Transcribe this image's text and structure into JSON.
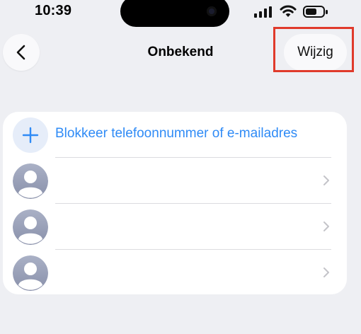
{
  "status_bar": {
    "time": "10:39",
    "icons": [
      "cellular-signal-icon",
      "wifi-icon",
      "battery-icon"
    ]
  },
  "nav": {
    "back_icon": "chevron-left-icon",
    "title": "Onbekend",
    "edit_label": "Wijzig"
  },
  "list": {
    "add_icon": "plus-icon",
    "add_label": "Blokkeer telefoonnummer of e-mailadres",
    "contacts": [
      {
        "name": "",
        "icon": "person-avatar-icon"
      },
      {
        "name": "",
        "icon": "person-avatar-icon"
      },
      {
        "name": "",
        "icon": "person-avatar-icon"
      }
    ]
  },
  "colors": {
    "accent": "#2f8bf6",
    "background": "#eeeff3",
    "highlight": "#e03a2b"
  }
}
